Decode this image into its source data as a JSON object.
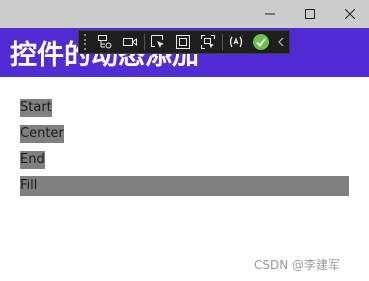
{
  "header": {
    "title": "控件的动态添加"
  },
  "window": {
    "minimize_icon": "minimize-icon",
    "maximize_icon": "maximize-icon",
    "close_icon": "close-icon",
    "titlebar_color": "#cccccc"
  },
  "devbar": {
    "tools": [
      "live-visual-tree-icon",
      "video-camera-icon",
      "select-element-icon",
      "display-adorners-icon",
      "track-focus-icon",
      "hot-reload-icon",
      "binding-check-icon",
      "collapse-chevron-icon"
    ],
    "status_color": "#6cc24a"
  },
  "theme": {
    "header_color": "#512bd4",
    "item_background": "#808080"
  },
  "items": [
    {
      "label": "Start"
    },
    {
      "label": "Center"
    },
    {
      "label": "End"
    },
    {
      "label": "Fill"
    }
  ],
  "watermark": "CSDN @李建军"
}
